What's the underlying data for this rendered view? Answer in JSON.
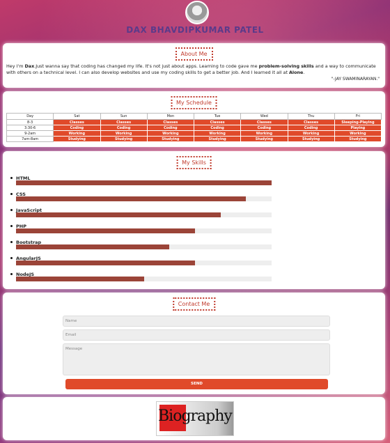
{
  "header": {
    "name": "DAX BHAVDIPKUMAR PATEL"
  },
  "about": {
    "title": "About Me",
    "text_parts": [
      "Hey I'm ",
      "Dax",
      ".Just wanna say that coding has changed my life. It's not just about apps. Learning to code gave me ",
      "problem-solving skills",
      " and a way to communicate with others on a technical level. I can also develop websites and use my coding skills to get a better job. And I learned it all at ",
      "Alone",
      "."
    ],
    "signature": "\"-JAY SWAMINARAYAN.\""
  },
  "schedule": {
    "title": "My Schedule",
    "headers": [
      "Day",
      "Sat",
      "Sun",
      "Mon",
      "Tue",
      "Wed",
      "Thu",
      "Fri"
    ],
    "rows": [
      [
        "8-3",
        "Classes",
        "Classes",
        "Classes",
        "Classes",
        "Classes",
        "Classes",
        "Sleeping-Playing"
      ],
      [
        "3:30-6",
        "Coding",
        "Coding",
        "Coding",
        "Coding",
        "Coding",
        "Coding",
        "Playing"
      ],
      [
        "9-2am",
        "Working",
        "Working",
        "Working",
        "Working",
        "Working",
        "Working",
        "Working"
      ],
      [
        "7am-8am",
        "Studying",
        "Studying",
        "Studying",
        "Studying",
        "Studying",
        "Studying",
        "Studying"
      ]
    ]
  },
  "skills": {
    "title": "My Skills",
    "items": [
      {
        "name": "HTML",
        "level": 100
      },
      {
        "name": "CSS",
        "level": 90
      },
      {
        "name": "JavaScript",
        "level": 80
      },
      {
        "name": "PHP",
        "level": 70
      },
      {
        "name": "Bootstrap",
        "level": 60
      },
      {
        "name": "AngularJS",
        "level": 70
      },
      {
        "name": "NodeJS",
        "level": 50
      }
    ]
  },
  "contact": {
    "title": "Contact Me",
    "name_placeholder": "Name",
    "email_placeholder": "Email",
    "message_placeholder": "Message",
    "send_label": "SEND"
  },
  "footer": {
    "logo_text": "Biography"
  },
  "colors": {
    "accent": "#e04a2a",
    "skill_bar": "#9b4438",
    "title_border": "#c0392b"
  }
}
